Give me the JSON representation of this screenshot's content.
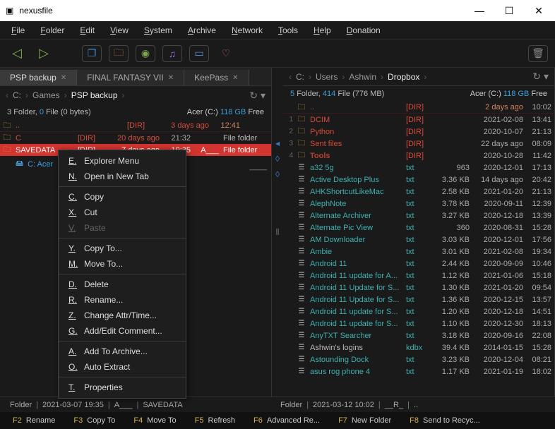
{
  "app": {
    "title": "nexusfile"
  },
  "menu": [
    "File",
    "Folder",
    "Edit",
    "View",
    "System",
    "Archive",
    "Network",
    "Tools",
    "Help",
    "Donation"
  ],
  "left": {
    "tabs": [
      {
        "label": "PSP backup",
        "active": true
      },
      {
        "label": "FINAL FANTASY VII",
        "active": false
      },
      {
        "label": "KeePass",
        "active": false
      }
    ],
    "crumb": [
      "C:",
      "Games",
      "PSP backup"
    ],
    "summary_folders": "3",
    "summary_files": "0",
    "summary_bytes": "(0 bytes)",
    "drive_label": "Acer (C:)",
    "drive_free": "118 GB",
    "free_label": "Free",
    "rows": [
      {
        "name": "..",
        "ext": "[DIR]",
        "size": "3 days ago",
        "date": "12:41",
        "time": "",
        "cls": "dir parent"
      },
      {
        "name": "C",
        "ext": "[DIR]",
        "size": "20 days ago",
        "date": "21:32",
        "time": "",
        "typ": "File folder",
        "cls": "dir"
      },
      {
        "name": "SAVEDATA",
        "ext": "[DIR]",
        "size": "7 days ago",
        "date": "19:35",
        "time": "A___",
        "typ": "File folder",
        "cls": "dir selected"
      }
    ],
    "drive_row": "C: Acer",
    "status": {
      "type": "Folder",
      "ts": "2021-03-07 19:35",
      "attr": "A___",
      "name": "SAVEDATA"
    }
  },
  "right": {
    "crumb": [
      "C:",
      "Users",
      "Ashwin",
      "Dropbox"
    ],
    "summary_folders": "5",
    "summary_files": "414",
    "summary_bytes": "(776 MB)",
    "drive_label": "Acer (C:)",
    "drive_free": "118 GB",
    "free_label": "Free",
    "rows": [
      {
        "ln": "",
        "name": "..",
        "ext": "[DIR]",
        "size": "",
        "date": "2 days ago",
        "time": "10:02",
        "cls": "dir parent"
      },
      {
        "ln": "1",
        "name": "DCIM",
        "ext": "[DIR]",
        "size": "",
        "date": "2021-02-08",
        "time": "13:41",
        "cls": "dir"
      },
      {
        "ln": "2",
        "name": "Python",
        "ext": "[DIR]",
        "size": "",
        "date": "2020-10-07",
        "time": "21:13",
        "cls": "dir"
      },
      {
        "ln": "3",
        "name": "Sent files",
        "ext": "[DIR]",
        "size": "",
        "date": "22 days ago",
        "time": "08:09",
        "cls": "dir"
      },
      {
        "ln": "4",
        "name": "Tools",
        "ext": "[DIR]",
        "size": "",
        "date": "2020-10-28",
        "time": "11:42",
        "cls": "dir tools"
      },
      {
        "ln": "",
        "name": "a32 5g",
        "ext": "txt",
        "size": "963",
        "date": "2020-12-01",
        "time": "17:13",
        "cls": "link"
      },
      {
        "ln": "",
        "name": "Active Desktop Plus",
        "ext": "txt",
        "size": "3.36 KB",
        "date": "14 days ago",
        "time": "20:42",
        "cls": "link"
      },
      {
        "ln": "",
        "name": "AHKShortcutLikeMac",
        "ext": "txt",
        "size": "2.58 KB",
        "date": "2021-01-20",
        "time": "21:13",
        "cls": "link"
      },
      {
        "ln": "",
        "name": "AlephNote",
        "ext": "txt",
        "size": "3.78 KB",
        "date": "2020-09-11",
        "time": "12:39",
        "cls": "link"
      },
      {
        "ln": "",
        "name": "Alternate Archiver",
        "ext": "txt",
        "size": "3.27 KB",
        "date": "2020-12-18",
        "time": "13:39",
        "cls": "link"
      },
      {
        "ln": "",
        "name": "Alternate Pic View",
        "ext": "txt",
        "size": "360",
        "date": "2020-08-31",
        "time": "15:28",
        "cls": "link"
      },
      {
        "ln": "",
        "name": "AM Downloader",
        "ext": "txt",
        "size": "3.03 KB",
        "date": "2020-12-01",
        "time": "17:56",
        "cls": "link"
      },
      {
        "ln": "",
        "name": "Ambie",
        "ext": "txt",
        "size": "3.01 KB",
        "date": "2021-02-08",
        "time": "19:34",
        "cls": "link"
      },
      {
        "ln": "",
        "name": "Android 11",
        "ext": "txt",
        "size": "2.44 KB",
        "date": "2020-09-09",
        "time": "10:46",
        "cls": "link"
      },
      {
        "ln": "",
        "name": "Android 11 update for A...",
        "ext": "txt",
        "size": "1.12 KB",
        "date": "2021-01-06",
        "time": "15:18",
        "cls": "link"
      },
      {
        "ln": "",
        "name": "Android 11 Update for S...",
        "ext": "txt",
        "size": "1.30 KB",
        "date": "2021-01-20",
        "time": "09:54",
        "cls": "link"
      },
      {
        "ln": "",
        "name": "Android 11 Update for S...",
        "ext": "txt",
        "size": "1.36 KB",
        "date": "2020-12-15",
        "time": "13:57",
        "cls": "link"
      },
      {
        "ln": "",
        "name": "Android 11 update for S...",
        "ext": "txt",
        "size": "1.20 KB",
        "date": "2020-12-18",
        "time": "14:51",
        "cls": "link"
      },
      {
        "ln": "",
        "name": "Android 11 update for S...",
        "ext": "txt",
        "size": "1.10 KB",
        "date": "2020-12-30",
        "time": "18:13",
        "cls": "link"
      },
      {
        "ln": "",
        "name": "AnyTXT Searcher",
        "ext": "txt",
        "size": "3.18 KB",
        "date": "2020-09-16",
        "time": "22:08",
        "cls": "link"
      },
      {
        "ln": "",
        "name": "Ashwin's logins",
        "ext": "kdbx",
        "size": "39.4 KB",
        "date": "2014-01-15",
        "time": "15:28",
        "cls": ""
      },
      {
        "ln": "",
        "name": "Astounding Dock",
        "ext": "txt",
        "size": "3.23 KB",
        "date": "2020-12-04",
        "time": "08:21",
        "cls": "link"
      },
      {
        "ln": "",
        "name": "asus rog phone 4",
        "ext": "txt",
        "size": "1.17 KB",
        "date": "2021-01-19",
        "time": "18:02",
        "cls": "link"
      }
    ],
    "status": {
      "type": "Folder",
      "ts": "2021-03-12 10:02",
      "attr": "__R_",
      "name": ".."
    }
  },
  "context": [
    {
      "k": "E",
      "label": "Explorer Menu"
    },
    {
      "k": "N",
      "label": "Open in New Tab"
    },
    "-",
    {
      "k": "C",
      "label": "Copy"
    },
    {
      "k": "X",
      "label": "Cut"
    },
    {
      "k": "V",
      "label": "Paste",
      "disabled": true
    },
    "-",
    {
      "k": "Y",
      "label": "Copy To..."
    },
    {
      "k": "M",
      "label": "Move To..."
    },
    "-",
    {
      "k": "D",
      "label": "Delete"
    },
    {
      "k": "R",
      "label": "Rename..."
    },
    {
      "k": "Z",
      "label": "Change Attr/Time..."
    },
    {
      "k": "G",
      "label": "Add/Edit Comment..."
    },
    "-",
    {
      "k": "A",
      "label": "Add To Archive..."
    },
    {
      "k": "O",
      "label": "Auto Extract"
    },
    "-",
    {
      "k": "T",
      "label": "Properties"
    }
  ],
  "fkeys": [
    {
      "n": "F2",
      "l": "Rename"
    },
    {
      "n": "F3",
      "l": "Copy To"
    },
    {
      "n": "F4",
      "l": "Move To"
    },
    {
      "n": "F5",
      "l": "Refresh"
    },
    {
      "n": "F6",
      "l": "Advanced Re..."
    },
    {
      "n": "F7",
      "l": "New Folder"
    },
    {
      "n": "F8",
      "l": "Send to Recyc..."
    }
  ],
  "labels": {
    "folder": "Folder",
    "file": "File",
    "file_folder": "File folder"
  }
}
